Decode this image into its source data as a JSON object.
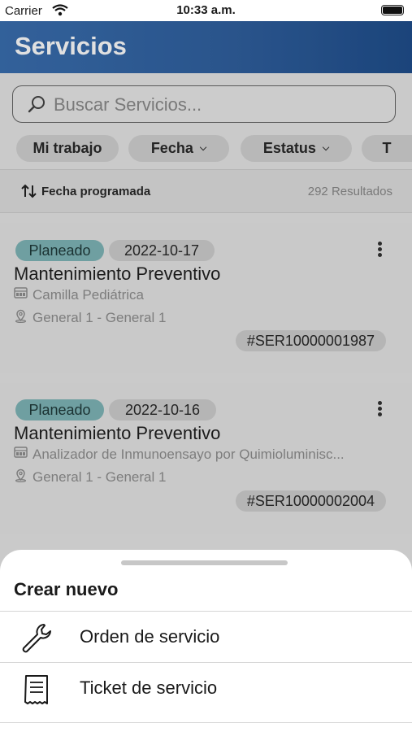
{
  "status_bar": {
    "carrier": "Carrier",
    "time": "10:33 a.m."
  },
  "header": {
    "title": "Servicios"
  },
  "search": {
    "placeholder": "Buscar Servicios..."
  },
  "filters": [
    {
      "label": "Mi trabajo",
      "dropdown": false
    },
    {
      "label": "Fecha",
      "dropdown": true
    },
    {
      "label": "Estatus",
      "dropdown": true
    },
    {
      "label": "T",
      "dropdown": false
    }
  ],
  "sort": {
    "label": "Fecha programada",
    "results": "292 Resultados"
  },
  "services": [
    {
      "status": "Planeado",
      "date": "2022-10-17",
      "name": "Mantenimiento Preventivo",
      "equipment": "Camilla Pediátrica",
      "location": "General 1 - General 1",
      "code": "#SER10000001987"
    },
    {
      "status": "Planeado",
      "date": "2022-10-16",
      "name": "Mantenimiento Preventivo",
      "equipment": "Analizador de Inmunoensayo por Quimioluminisc...",
      "location": "General 1 - General 1",
      "code": "#SER10000002004"
    }
  ],
  "sheet": {
    "title": "Crear nuevo",
    "options": [
      {
        "label": "Orden de servicio",
        "icon": "wrench-icon"
      },
      {
        "label": "Ticket de servicio",
        "icon": "receipt-icon"
      }
    ]
  },
  "colors": {
    "header": "#2f5f9e",
    "status_badge": "#7fb6b8"
  }
}
